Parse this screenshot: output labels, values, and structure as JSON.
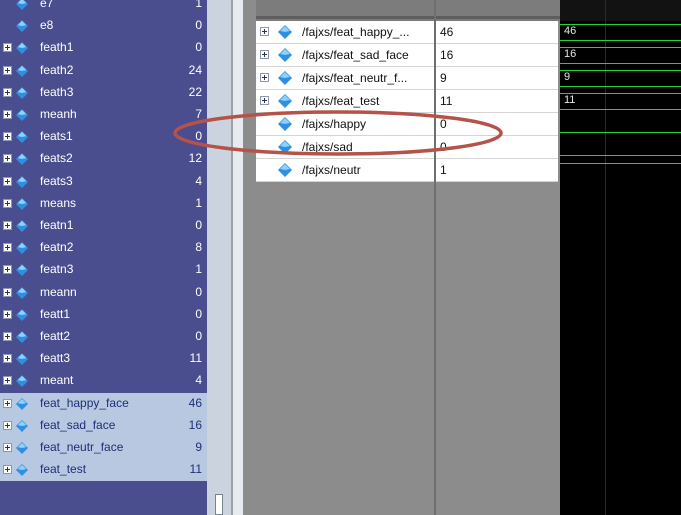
{
  "left_panel": {
    "rows": [
      {
        "name": "e7",
        "value": "1",
        "expand": false
      },
      {
        "name": "e8",
        "value": "0",
        "expand": false
      },
      {
        "name": "feath1",
        "value": "0",
        "expand": true
      },
      {
        "name": "feath2",
        "value": "24",
        "expand": true
      },
      {
        "name": "feath3",
        "value": "22",
        "expand": true
      },
      {
        "name": "meanh",
        "value": "7",
        "expand": true
      },
      {
        "name": "feats1",
        "value": "0",
        "expand": true
      },
      {
        "name": "feats2",
        "value": "12",
        "expand": true
      },
      {
        "name": "feats3",
        "value": "4",
        "expand": true
      },
      {
        "name": "means",
        "value": "1",
        "expand": true
      },
      {
        "name": "featn1",
        "value": "0",
        "expand": true
      },
      {
        "name": "featn2",
        "value": "8",
        "expand": true
      },
      {
        "name": "featn3",
        "value": "1",
        "expand": true
      },
      {
        "name": "meann",
        "value": "0",
        "expand": true
      },
      {
        "name": "featt1",
        "value": "0",
        "expand": true
      },
      {
        "name": "featt2",
        "value": "0",
        "expand": true
      },
      {
        "name": "featt3",
        "value": "11",
        "expand": true
      },
      {
        "name": "meant",
        "value": "4",
        "expand": true
      },
      {
        "name": "feat_happy_face",
        "value": "46",
        "expand": true,
        "selected": true
      },
      {
        "name": "feat_sad_face",
        "value": "16",
        "expand": true,
        "selected": true
      },
      {
        "name": "feat_neutr_face",
        "value": "9",
        "expand": true,
        "selected": true
      },
      {
        "name": "feat_test",
        "value": "11",
        "expand": true,
        "selected": true
      }
    ]
  },
  "signal_list": {
    "rows": [
      {
        "name": "/fajxs/feat_happy_...",
        "value": "46",
        "expand": true,
        "wave": "bus",
        "wave_label": "46"
      },
      {
        "name": "/fajxs/feat_sad_face",
        "value": "16",
        "expand": true,
        "wave": "bus",
        "wave_label": "16"
      },
      {
        "name": "/fajxs/feat_neutr_f...",
        "value": "9",
        "expand": true,
        "wave": "bus",
        "wave_label": "9"
      },
      {
        "name": "/fajxs/feat_test",
        "value": "11",
        "expand": true,
        "wave": "bus",
        "wave_label": "11"
      },
      {
        "name": "/fajxs/happy",
        "value": "0",
        "expand": false,
        "wave": "low"
      },
      {
        "name": "/fajxs/sad",
        "value": "0",
        "expand": false,
        "wave": "low"
      },
      {
        "name": "/fajxs/neutr",
        "value": "1",
        "expand": false,
        "wave": "high"
      }
    ]
  },
  "annotation": {
    "color": "#b5524a"
  },
  "colors": {
    "left_bg": "#4a4e8e",
    "wave_green": "#1fd33b",
    "signal_icon": "#2f8fe0"
  }
}
